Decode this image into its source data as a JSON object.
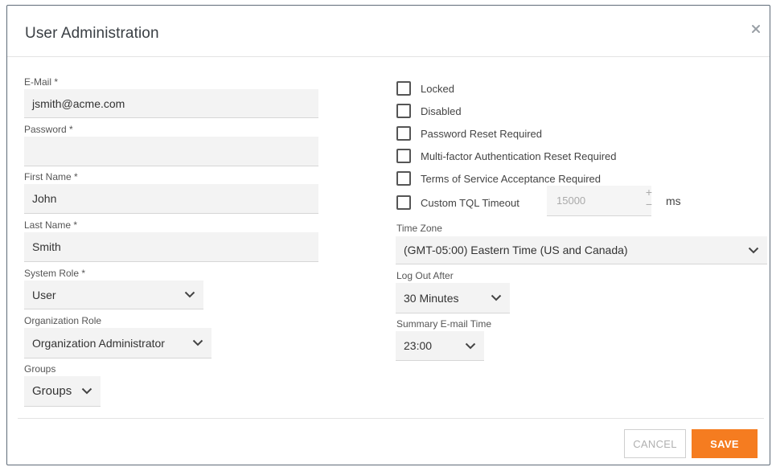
{
  "dialog": {
    "title": "User Administration",
    "close_icon": "close-icon"
  },
  "left": {
    "email": {
      "label": "E-Mail *",
      "value": "jsmith@acme.com"
    },
    "password": {
      "label": "Password *",
      "value": ""
    },
    "first_name": {
      "label": "First Name *",
      "value": "John"
    },
    "last_name": {
      "label": "Last Name *",
      "value": "Smith"
    },
    "system_role": {
      "label": "System Role *",
      "value": "User"
    },
    "organization_role": {
      "label": "Organization Role",
      "value": "Organization Administrator"
    },
    "groups": {
      "label": "Groups",
      "value": "Groups"
    }
  },
  "right": {
    "checkboxes": [
      {
        "label": "Locked",
        "checked": false
      },
      {
        "label": "Disabled",
        "checked": false
      },
      {
        "label": "Password Reset Required",
        "checked": false
      },
      {
        "label": "Multi-factor Authentication Reset Required",
        "checked": false
      },
      {
        "label": "Terms of Service Acceptance Required",
        "checked": false
      },
      {
        "label": "Custom TQL Timeout",
        "checked": false
      }
    ],
    "tql_timeout": {
      "value": "15000",
      "unit": "ms",
      "plus": "+",
      "minus": "−"
    },
    "time_zone": {
      "label": "Time Zone",
      "value": "(GMT-05:00) Eastern Time (US and Canada)"
    },
    "log_out_after": {
      "label": "Log Out After",
      "value": "30 Minutes"
    },
    "summary_email_time": {
      "label": "Summary E-mail Time",
      "value": "23:00"
    }
  },
  "footer": {
    "cancel_label": "CANCEL",
    "save_label": "SAVE"
  },
  "colors": {
    "accent": "#f57c20",
    "border": "#5f6b78",
    "field_bg": "#f3f3f3"
  }
}
